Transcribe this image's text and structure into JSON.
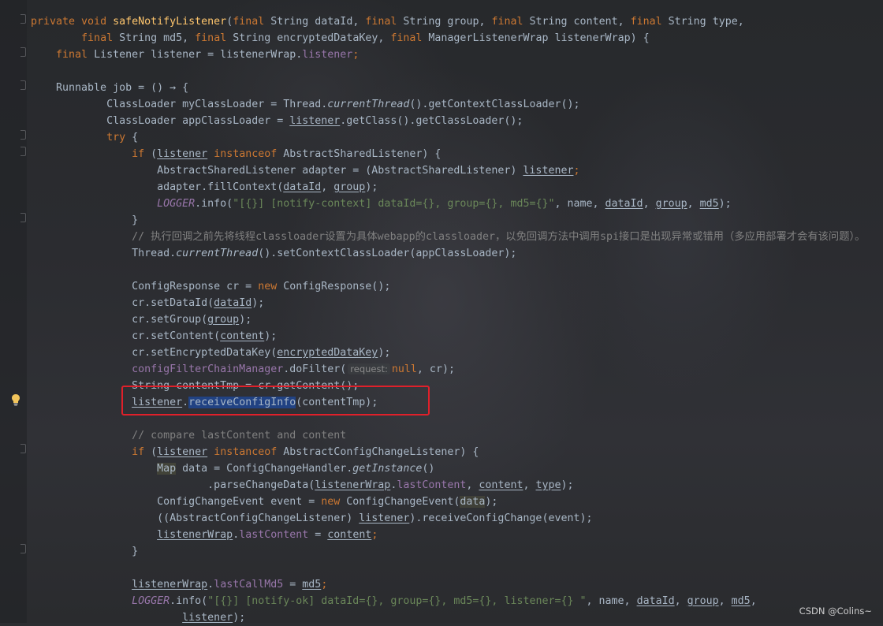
{
  "editor": {
    "lines": [
      [
        [
          "kw",
          "private "
        ],
        [
          "kw",
          "void "
        ],
        [
          "fn",
          "safeNotifyListener"
        ],
        [
          "p",
          "("
        ],
        [
          "kw",
          "final "
        ],
        [
          "p",
          "String dataId, "
        ],
        [
          "kw",
          "final "
        ],
        [
          "p",
          "String group, "
        ],
        [
          "kw",
          "final "
        ],
        [
          "p",
          "String content, "
        ],
        [
          "kw",
          "final "
        ],
        [
          "p",
          "String type,"
        ]
      ],
      [
        [
          "p",
          "        "
        ],
        [
          "kw",
          "final "
        ],
        [
          "p",
          "String md5, "
        ],
        [
          "kw",
          "final "
        ],
        [
          "p",
          "String encryptedDataKey, "
        ],
        [
          "kw",
          "final "
        ],
        [
          "p",
          "ManagerListenerWrap listenerWrap) {"
        ]
      ],
      [
        [
          "p",
          "    "
        ],
        [
          "kw",
          "final "
        ],
        [
          "p",
          "Listener listener = listenerWrap."
        ],
        [
          "fd",
          "listener"
        ],
        [
          "kw",
          ";"
        ]
      ],
      [],
      [
        [
          "p",
          "    Runnable job = () → {"
        ]
      ],
      [
        [
          "p",
          "            ClassLoader myClassLoader = Thread."
        ],
        [
          "it",
          "currentThread"
        ],
        [
          "p",
          "().getContextClassLoader();"
        ]
      ],
      [
        [
          "p",
          "            ClassLoader appClassLoader = "
        ],
        [
          "ul",
          "listener"
        ],
        [
          "p",
          ".getClass().getClassLoader();"
        ]
      ],
      [
        [
          "p",
          "            "
        ],
        [
          "kw",
          "try "
        ],
        [
          "p",
          "{"
        ]
      ],
      [
        [
          "p",
          "                "
        ],
        [
          "kw",
          "if "
        ],
        [
          "p",
          "("
        ],
        [
          "ul",
          "listener"
        ],
        [
          "kw",
          " instanceof "
        ],
        [
          "p",
          "AbstractSharedListener) {"
        ]
      ],
      [
        [
          "p",
          "                    AbstractSharedListener adapter = (AbstractSharedListener) "
        ],
        [
          "ul",
          "listener"
        ],
        [
          "kw",
          ";"
        ]
      ],
      [
        [
          "p",
          "                    adapter.fillContext("
        ],
        [
          "ul",
          "dataId"
        ],
        [
          "p",
          ", "
        ],
        [
          "ul",
          "group"
        ],
        [
          "p",
          ");"
        ]
      ],
      [
        [
          "p",
          "                    "
        ],
        [
          "lg",
          "LOGGER"
        ],
        [
          "p",
          ".info("
        ],
        [
          "st",
          "\"[{}] [notify-context] dataId={}, group={}, md5={}\""
        ],
        [
          "p",
          ", name, "
        ],
        [
          "ul",
          "dataId"
        ],
        [
          "p",
          ", "
        ],
        [
          "ul",
          "group"
        ],
        [
          "p",
          ", "
        ],
        [
          "ul",
          "md5"
        ],
        [
          "p",
          ");"
        ]
      ],
      [
        [
          "p",
          "                }"
        ]
      ],
      [
        [
          "p",
          "                "
        ],
        [
          "cm",
          "// 执行回调之前先将线程classloader设置为具体webapp的classloader，以免回调方法中调用spi接口是出现异常或错用（多应用部署才会有该问题）。"
        ]
      ],
      [
        [
          "p",
          "                Thread."
        ],
        [
          "it",
          "currentThread"
        ],
        [
          "p",
          "().setContextClassLoader(appClassLoader);"
        ]
      ],
      [],
      [
        [
          "p",
          "                ConfigResponse cr = "
        ],
        [
          "kw",
          "new "
        ],
        [
          "p",
          "ConfigResponse();"
        ]
      ],
      [
        [
          "p",
          "                cr.setDataId("
        ],
        [
          "ul",
          "dataId"
        ],
        [
          "p",
          ");"
        ]
      ],
      [
        [
          "p",
          "                cr.setGroup("
        ],
        [
          "ul",
          "group"
        ],
        [
          "p",
          ");"
        ]
      ],
      [
        [
          "p",
          "                cr.setContent("
        ],
        [
          "ul",
          "content"
        ],
        [
          "p",
          ");"
        ]
      ],
      [
        [
          "p",
          "                cr.setEncryptedDataKey("
        ],
        [
          "ul",
          "encryptedDataKey"
        ],
        [
          "p",
          ");"
        ]
      ],
      [
        [
          "p",
          "                "
        ],
        [
          "fd",
          "configFilterChainManager"
        ],
        [
          "p",
          ".doFilter("
        ],
        [
          "hint",
          "request:"
        ],
        [
          "kw",
          "null"
        ],
        [
          "p",
          ", cr);"
        ]
      ],
      [
        [
          "p",
          "                String contentTmp = cr.getContent();"
        ]
      ],
      [
        [
          "p",
          "                "
        ],
        [
          "ul",
          "listener"
        ],
        [
          "p",
          "."
        ],
        [
          "sel",
          "receiveConfigInfo"
        ],
        [
          "p",
          "(contentTmp);"
        ]
      ],
      [],
      [
        [
          "p",
          "                "
        ],
        [
          "cm",
          "// compare lastContent and content"
        ]
      ],
      [
        [
          "p",
          "                "
        ],
        [
          "kw",
          "if "
        ],
        [
          "p",
          "("
        ],
        [
          "ul",
          "listener"
        ],
        [
          "kw",
          " instanceof "
        ],
        [
          "p",
          "AbstractConfigChangeListener) {"
        ]
      ],
      [
        [
          "p",
          "                    "
        ],
        [
          "map",
          "Map"
        ],
        [
          "p",
          " data = ConfigChangeHandler."
        ],
        [
          "it",
          "getInstance"
        ],
        [
          "p",
          "()"
        ]
      ],
      [
        [
          "p",
          "                            .parseChangeData("
        ],
        [
          "ul",
          "listenerWrap"
        ],
        [
          "p",
          "."
        ],
        [
          "fd",
          "lastContent"
        ],
        [
          "p",
          ", "
        ],
        [
          "ul",
          "content"
        ],
        [
          "p",
          ", "
        ],
        [
          "ul",
          "type"
        ],
        [
          "p",
          ");"
        ]
      ],
      [
        [
          "p",
          "                    ConfigChangeEvent event = "
        ],
        [
          "kw",
          "new "
        ],
        [
          "p",
          "ConfigChangeEvent("
        ],
        [
          "data",
          "data"
        ],
        [
          "p",
          ");"
        ]
      ],
      [
        [
          "p",
          "                    ((AbstractConfigChangeListener) "
        ],
        [
          "ul",
          "listener"
        ],
        [
          "p",
          ").receiveConfigChange(event);"
        ]
      ],
      [
        [
          "p",
          "                    "
        ],
        [
          "ul",
          "listenerWrap"
        ],
        [
          "p",
          "."
        ],
        [
          "fd",
          "lastContent"
        ],
        [
          "p",
          " = "
        ],
        [
          "ul",
          "content"
        ],
        [
          "kw",
          ";"
        ]
      ],
      [
        [
          "p",
          "                }"
        ]
      ],
      [],
      [
        [
          "p",
          "                "
        ],
        [
          "ul",
          "listenerWrap"
        ],
        [
          "p",
          "."
        ],
        [
          "fd",
          "lastCallMd5"
        ],
        [
          "p",
          " = "
        ],
        [
          "ul",
          "md5"
        ],
        [
          "kw",
          ";"
        ]
      ],
      [
        [
          "p",
          "                "
        ],
        [
          "lg",
          "LOGGER"
        ],
        [
          "p",
          ".info("
        ],
        [
          "st",
          "\"[{}] [notify-ok] dataId={}, group={}, md5={}, listener={} \""
        ],
        [
          "p",
          ", name, "
        ],
        [
          "ul",
          "dataId"
        ],
        [
          "p",
          ", "
        ],
        [
          "ul",
          "group"
        ],
        [
          "p",
          ", "
        ],
        [
          "ul",
          "md5"
        ],
        [
          "p",
          ","
        ]
      ],
      [
        [
          "p",
          "                        "
        ],
        [
          "ul",
          "listener"
        ],
        [
          "p",
          ");"
        ]
      ]
    ]
  },
  "watermark": "CSDN @Colins~",
  "icons": {
    "gutter": "lightbulb-icon",
    "fold": "fold-marker-icon"
  },
  "colors": {
    "highlight_box": "#e0202a",
    "selection": "#214283"
  }
}
